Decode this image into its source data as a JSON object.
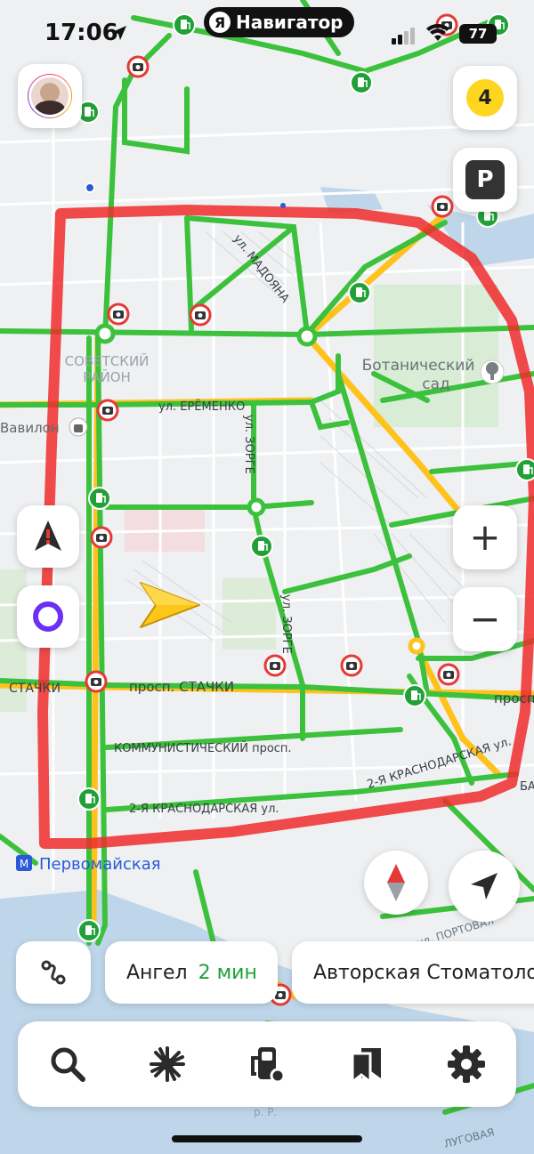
{
  "status_bar": {
    "time": "17:06",
    "app_name": "Навигатор",
    "app_logo_letter": "Я",
    "battery": "77"
  },
  "map": {
    "labels": {
      "district": [
        "СОВЕТСКИЙ",
        "РАЙОН"
      ],
      "garden": [
        "Ботанический",
        "сад"
      ],
      "street_madoyana": "ул. МАДОЯНА",
      "street_eremenko": "ул. ЕРЁМЕНКО",
      "vavilon": "Вавилон",
      "street_zorge_1": "ул. ЗОРГЕ",
      "street_zorge_2": "ул. ЗОРГЕ",
      "street_stachki_left": "СТАЧКИ",
      "street_stachki_main": "просп. СТАЧКИ",
      "street_stachki_right": "просп.",
      "street_kommunistichesky": "КОММУНИСТИЧЕСКИЙ просп.",
      "street_krasnodarskaya_1": "2-Я КРАСНОДАРСКАЯ ул.",
      "street_krasnodarskaya_2": "2-Я КРАСНОДАРСКАЯ ул.",
      "street_ba": "БА",
      "metro": "Первомайская",
      "portovaya": "ул. ПОРТОВАЯ",
      "lugovaya": "ЛУГОВАЯ",
      "rr": "р. Р."
    },
    "colors": {
      "traffic_free": "#3cc13c",
      "traffic_slow": "#ffc21c",
      "route_outline": "#ee2b2b",
      "background": "#eef0f2"
    }
  },
  "controls": {
    "notifications_count": "4",
    "parking_label": "P",
    "zoom_in": "+",
    "zoom_out": "−"
  },
  "suggestions": [
    {
      "name": "Ангел",
      "eta": "2 мин"
    },
    {
      "name": "Авторская Стоматология",
      "eta": ""
    }
  ],
  "tabbar": {
    "icons": [
      "search-icon",
      "discovery-icon",
      "gas-station-icon",
      "bookmarks-icon",
      "settings-icon"
    ]
  }
}
